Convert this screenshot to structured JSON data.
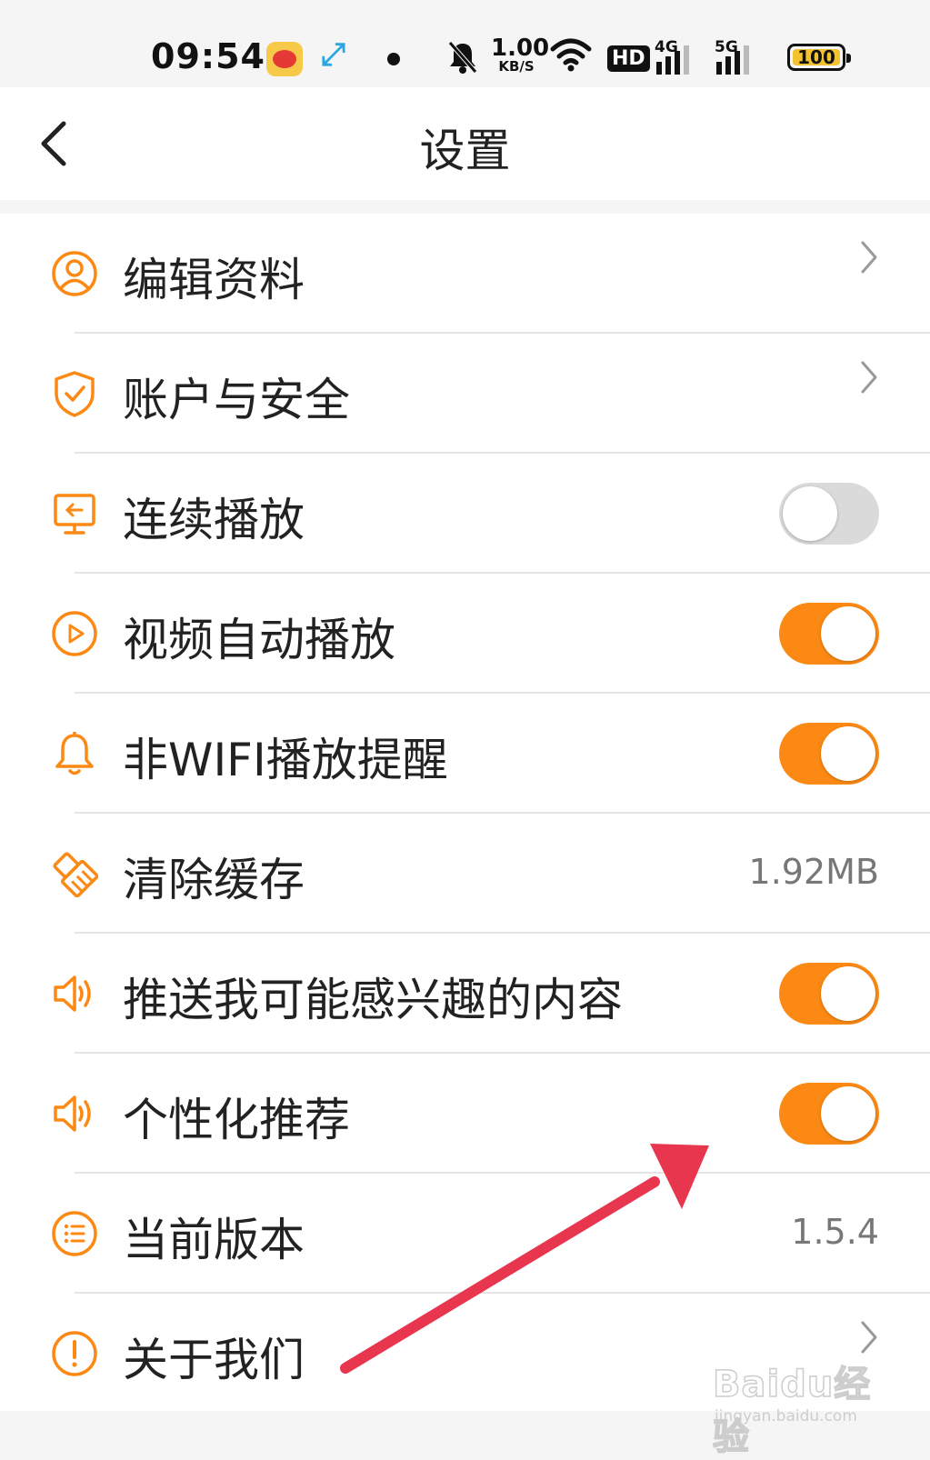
{
  "status_bar": {
    "time": "09:54",
    "net_speed_value": "1.00",
    "net_speed_unit": "KB/S",
    "hd_badge": "HD",
    "signal_1": "4G",
    "signal_2": "5G",
    "battery": "100",
    "icons": [
      "weibo-icon",
      "app-icon",
      "notification-dot",
      "mute-bell-icon",
      "wifi-icon",
      "signal-icon",
      "battery-icon"
    ]
  },
  "header": {
    "title": "设置",
    "back_icon": "chevron-left-icon"
  },
  "settings": [
    {
      "label": "编辑资料",
      "icon": "user-icon",
      "control": "chevron"
    },
    {
      "label": "账户与安全",
      "icon": "shield-check-icon",
      "control": "chevron"
    },
    {
      "label": "连续播放",
      "icon": "monitor-icon",
      "control": "toggle",
      "on": false
    },
    {
      "label": "视频自动播放",
      "icon": "play-circle-icon",
      "control": "toggle",
      "on": true
    },
    {
      "label": "非WIFI播放提醒",
      "icon": "bell-icon",
      "control": "toggle",
      "on": true
    },
    {
      "label": "清除缓存",
      "icon": "broom-icon",
      "control": "value",
      "value": "1.92MB"
    },
    {
      "label": "推送我可能感兴趣的内容",
      "icon": "speaker-icon",
      "control": "toggle",
      "on": true
    },
    {
      "label": "个性化推荐",
      "icon": "speaker-icon",
      "control": "toggle",
      "on": true
    },
    {
      "label": "当前版本",
      "icon": "list-circle-icon",
      "control": "value",
      "value": "1.5.4"
    },
    {
      "label": "关于我们",
      "icon": "exclamation-circle-icon",
      "control": "chevron"
    }
  ],
  "annotation": {
    "arrow_color": "#e8364f"
  },
  "watermark": {
    "brand": "Baidu经验",
    "url": "jingyan.baidu.com"
  },
  "colors": {
    "accent": "#fc8913",
    "toggle_off": "#dadada",
    "text": "#222222",
    "secondary_text": "#777777"
  }
}
